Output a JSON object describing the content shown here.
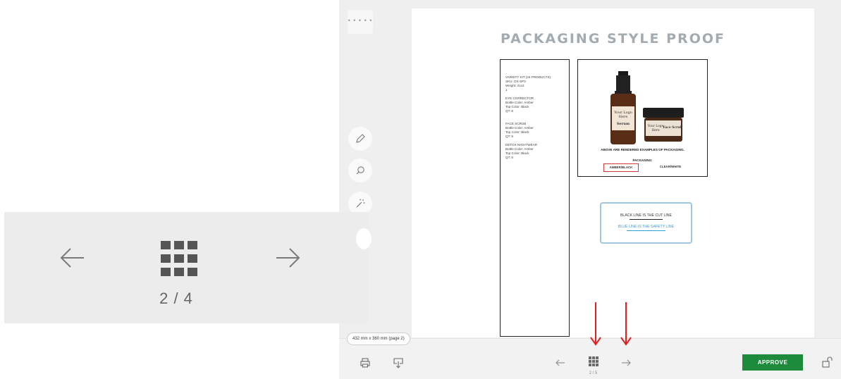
{
  "document": {
    "title": "PACKAGING STYLE PROOF",
    "specs": [
      "VARIETY KIT (24 PRODUCTS)",
      "SKU: OX-SP3",
      "Weight: 21oz",
      "1",
      "EYE CORRECTOR",
      "Bottle Color: Amber",
      "Top Color: Black",
      "QT: 8",
      "FACE SCRUB",
      "Bottle Color: Amber",
      "Top Color: Black",
      "QT: 8",
      "DETOX NIGHTWEAR",
      "Bottle Color: Amber",
      "Top Color: Black",
      "QT: 8"
    ],
    "products": {
      "bottle_line1": "Your Logo",
      "bottle_line2": "Here",
      "bottle_name": "Serum",
      "jar_line1": "Your Logo",
      "jar_line2": "Here",
      "jar_name": "Face Scrub"
    },
    "caption": "ABOVE ARE RENDERED EXAMPLES OF PACKAGING.",
    "packaging_label": "PACKAGING:",
    "option_selected": "AMBER/BLACK",
    "option_other": "CLEAR/WHITE",
    "cut_line": "BLACK LINE IS THE CUT LINE",
    "safety_line": "BLUE LINE IS THE SAFETY LINE"
  },
  "toolbar": {
    "size_label": "432 mm x 360 mm (page 2)",
    "approve_label": "APPROVE",
    "page_counter": "2 / 5"
  },
  "zoom": {
    "page_counter": "2 / 4"
  },
  "colors": {
    "approve": "#1e8a3c",
    "annotation_arrow": "#e02020",
    "safety_line": "#2f9fd8"
  },
  "icons": [
    "menu-dots-icon",
    "pen-icon",
    "zoom-icon",
    "magic-wand-icon",
    "print-icon",
    "download-icon",
    "arrow-left-icon",
    "grid-icon",
    "arrow-right-icon",
    "unlock-icon"
  ]
}
